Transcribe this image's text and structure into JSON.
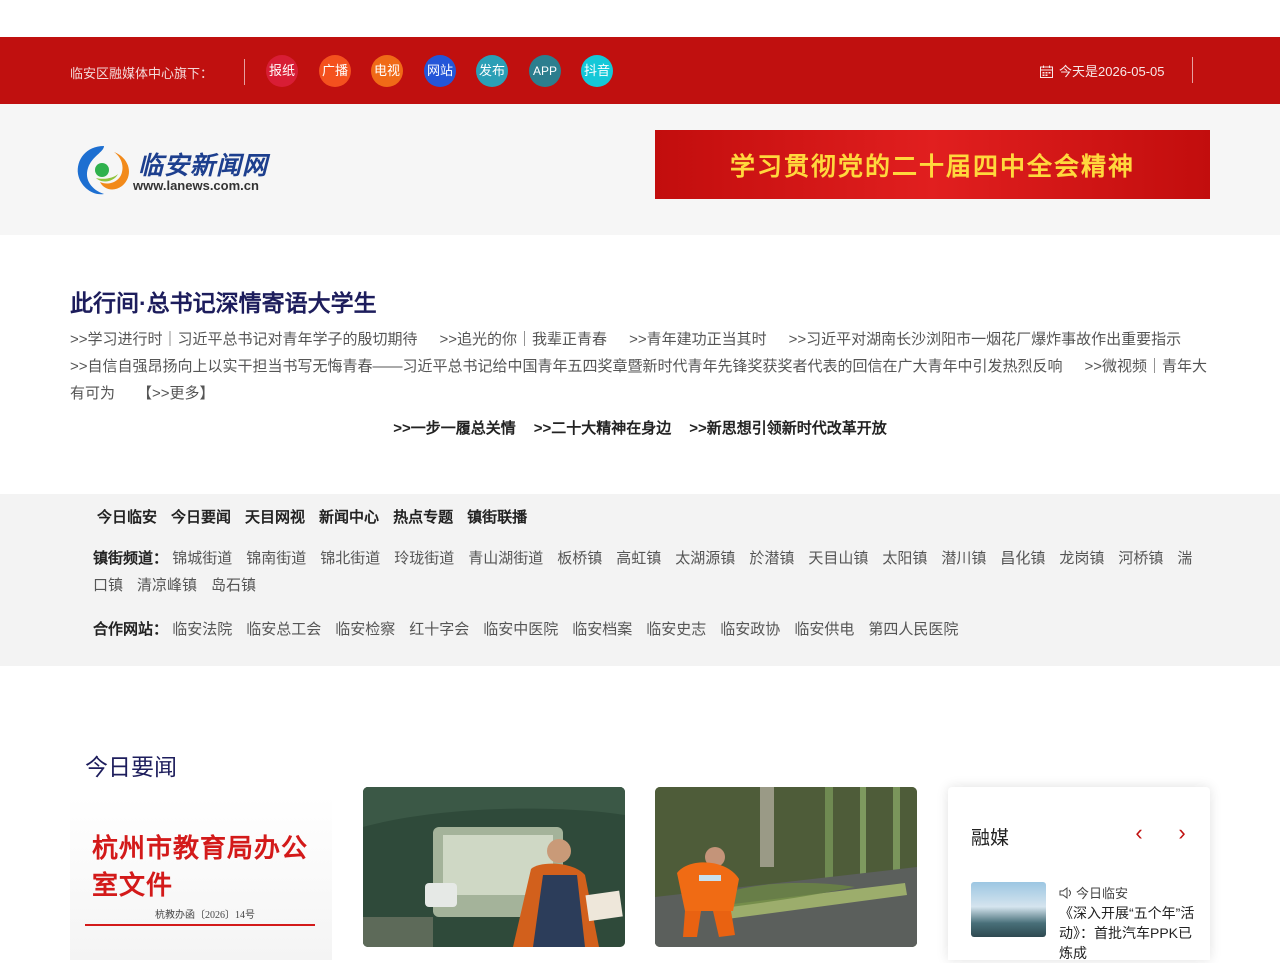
{
  "topbar": {
    "label": "临安区融媒体中心旗下：",
    "media": [
      {
        "label": "报纸",
        "color": "#d81d35"
      },
      {
        "label": "广播",
        "color": "#f4511e"
      },
      {
        "label": "电视",
        "color": "#f06a17"
      },
      {
        "label": "网站",
        "color": "#2456d8"
      },
      {
        "label": "发布",
        "color": "#2b9fb6"
      },
      {
        "label": "APP",
        "color": "#2c7e8e"
      },
      {
        "label": "抖音",
        "color": "#14c8d8"
      }
    ],
    "date": "今天是2026-05-05"
  },
  "header": {
    "logo_title": "临安新闻网",
    "logo_url": "www.lanews.com.cn",
    "banner_text": "学习贯彻党的二十届四中全会精神"
  },
  "topic": {
    "title": "此行间·总书记深情寄语大学生",
    "links": [
      ">>学习进行时｜习近平总书记对青年学子的殷切期待",
      ">>追光的你｜我辈正青春",
      ">>青年建功正当其时",
      ">>习近平对湖南长沙浏阳市一烟花厂爆炸事故作出重要指示",
      ">>自信自强昂扬向上以实干担当书写无悔青春——习近平总书记给中国青年五四奖章暨新时代青年先锋奖获奖者代表的回信在广大青年中引发热烈反响",
      ">>微视频｜青年大有可为"
    ],
    "more": "【>>更多】",
    "sub_links": [
      ">>一步一履总关情",
      ">>二十大精神在身边",
      ">>新思想引领新时代改革开放"
    ]
  },
  "nav": {
    "main": [
      "今日临安",
      "今日要闻",
      "天目网视",
      "新闻中心",
      "热点专题",
      "镇街联播"
    ],
    "towns_label": "镇街频道：",
    "towns": [
      "锦城街道",
      "锦南街道",
      "锦北街道",
      "玲珑街道",
      "青山湖街道",
      "板桥镇",
      "高虹镇",
      "太湖源镇",
      "於潜镇",
      "天目山镇",
      "太阳镇",
      "潜川镇",
      "昌化镇",
      "龙岗镇",
      "河桥镇",
      "湍口镇",
      "清凉峰镇",
      "岛石镇"
    ],
    "partners_label": "合作网站：",
    "partners": [
      "临安法院",
      "临安总工会",
      "临安检察",
      "红十字会",
      "临安中医院",
      "临安档案",
      "临安史志",
      "临安政协",
      "临安供电",
      "第四人民医院"
    ]
  },
  "news": {
    "section_title": "今日要闻",
    "doc_title": "杭州市教育局办公室文件",
    "doc_number": "杭教办函〔2026〕14号"
  },
  "rongmei": {
    "title": "融媒",
    "item_source": "今日临安",
    "item_text": "《深入开展“五个年”活动》：首批汽车PPK已炼成"
  }
}
